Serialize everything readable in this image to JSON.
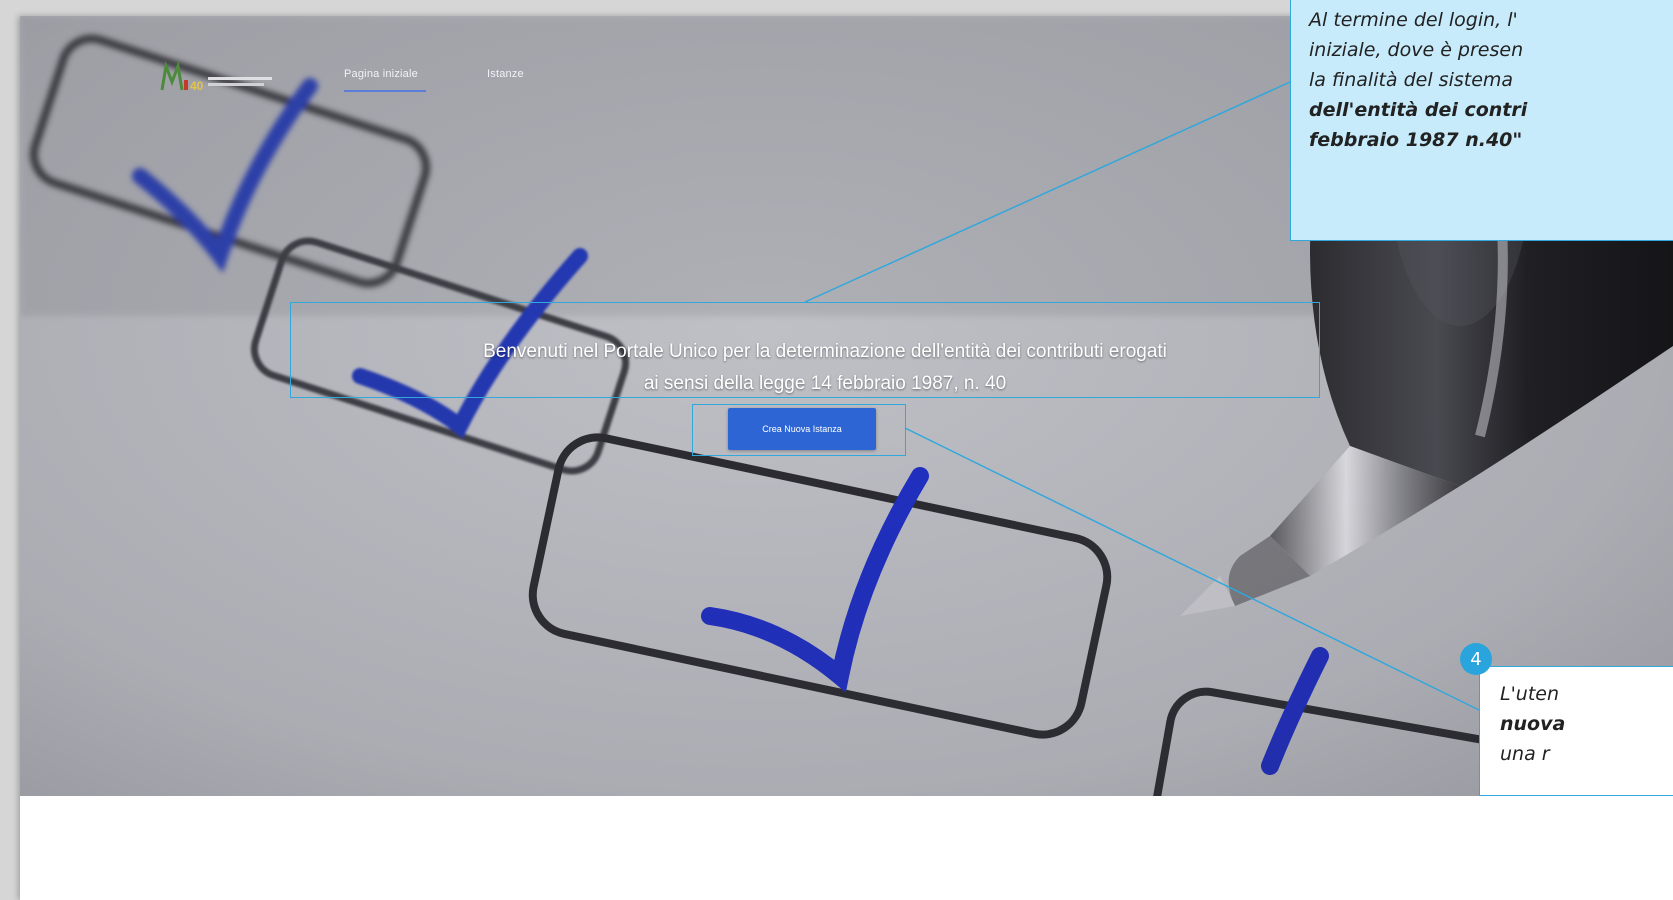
{
  "nav": {
    "logo_text": "M40",
    "home_label": "Pagina iniziale",
    "istanze_label": "Istanze"
  },
  "hero": {
    "welcome_line1": "Benvenuti nel Portale Unico per la determinazione dell'entità dei contributi erogati",
    "welcome_line2": "ai sensi della legge 14 febbraio 1987, n. 40",
    "cta_label": "Crea Nuova Istanza"
  },
  "annotations": {
    "callout1_line1": "Al termine del login, l'",
    "callout1_line2": "iniziale, dove è presen",
    "callout1_line3": "la finalità del sistema",
    "callout1_line4": "dell'entità dei contri",
    "callout1_line5": "febbraio 1987 n.40\"",
    "callout2_badge": "4",
    "callout2_line1": "L'uten",
    "callout2_line2": "nuova",
    "callout2_line3": "una r"
  },
  "colors": {
    "accent": "#31a7db",
    "cta": "#2d66d4",
    "callout_bg": "#c7ebfb",
    "nav_underline": "#5b7fd6"
  }
}
